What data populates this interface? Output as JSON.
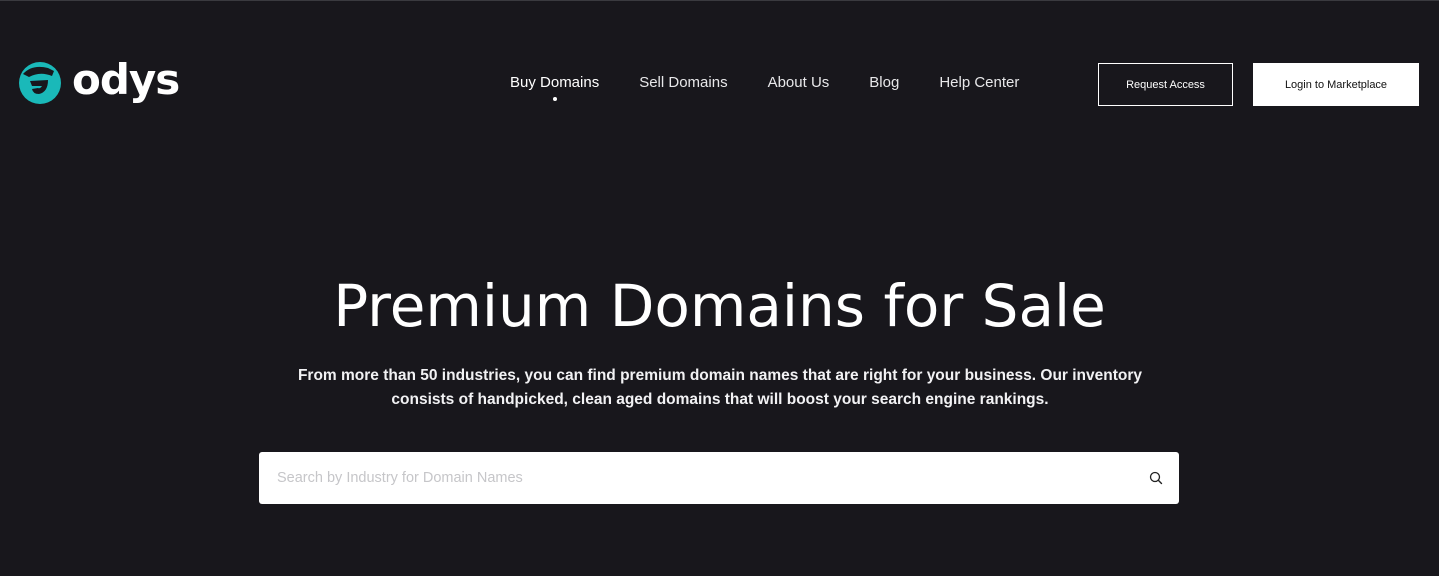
{
  "brand": {
    "name": "odys",
    "accent_color": "#1ab9b9"
  },
  "nav": {
    "items": [
      {
        "label": "Buy Domains",
        "active": true
      },
      {
        "label": "Sell Domains",
        "active": false
      },
      {
        "label": "About Us",
        "active": false
      },
      {
        "label": "Blog",
        "active": false
      },
      {
        "label": "Help Center",
        "active": false
      }
    ]
  },
  "header_actions": {
    "request_access_label": "Request Access",
    "login_label": "Login to Marketplace"
  },
  "hero": {
    "title": "Premium Domains for Sale",
    "subtitle": "From more than 50 industries, you can find premium domain names that are right for your business. Our inventory consists of handpicked, clean aged domains that will boost your search engine rankings."
  },
  "search": {
    "placeholder": "Search by Industry for Domain Names",
    "value": "",
    "icon": "search-icon"
  },
  "colors": {
    "background": "#18171c",
    "text": "#ffffff"
  }
}
